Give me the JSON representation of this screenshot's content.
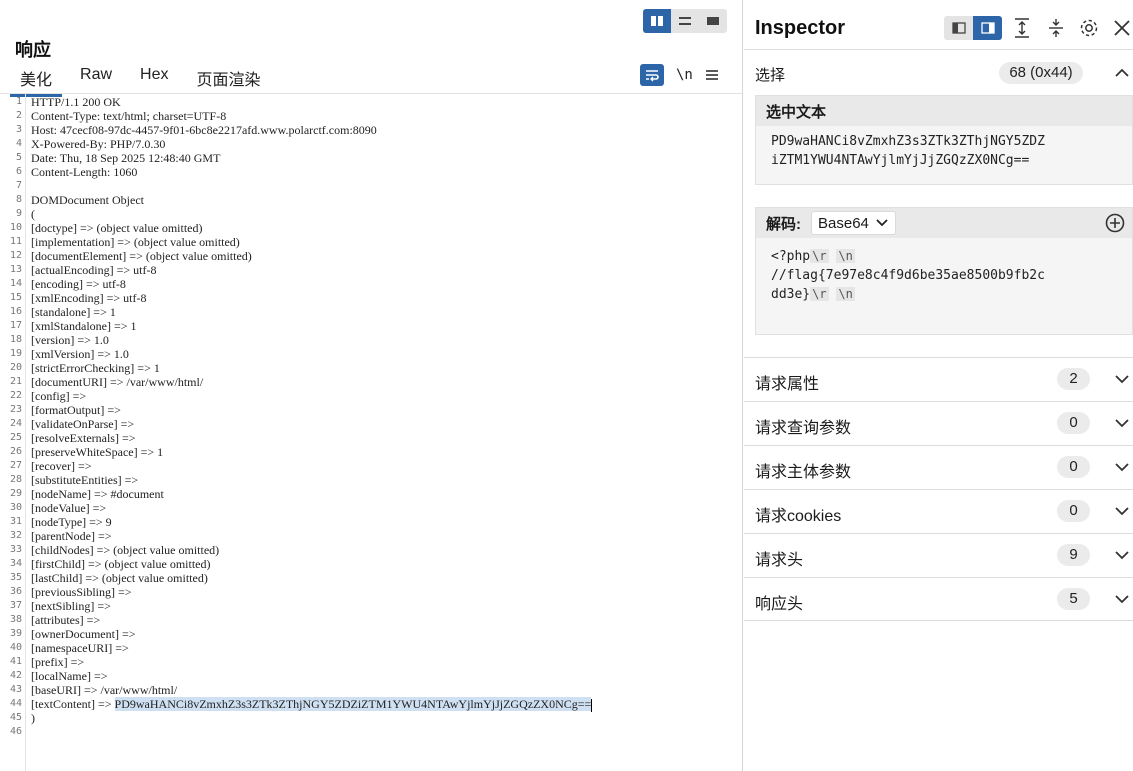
{
  "response": {
    "title": "响应",
    "tabs": [
      {
        "label": "美化",
        "active": true
      },
      {
        "label": "Raw",
        "active": false
      },
      {
        "label": "Hex",
        "active": false
      },
      {
        "label": "页面渲染",
        "active": false
      }
    ],
    "newline_label": "\\n",
    "lines": [
      "HTTP/1.1 200 OK",
      "Content-Type: text/html; charset=UTF-8",
      "Host: 47cecf08-97dc-4457-9f01-6bc8e2217afd.www.polarctf.com:8090",
      "X-Powered-By: PHP/7.0.30",
      "Date: Thu, 18 Sep 2025 12:48:40 GMT",
      "Content-Length: 1060",
      "",
      "DOMDocument Object",
      "(",
      "[doctype] => (object value omitted)",
      "[implementation] => (object value omitted)",
      "[documentElement] => (object value omitted)",
      "[actualEncoding] => utf-8",
      "[encoding] => utf-8",
      "[xmlEncoding] => utf-8",
      "[standalone] => 1",
      "[xmlStandalone] => 1",
      "[version] => 1.0",
      "[xmlVersion] => 1.0",
      "[strictErrorChecking] => 1",
      "[documentURI] => /var/www/html/",
      "[config] =>",
      "[formatOutput] =>",
      "[validateOnParse] =>",
      "[resolveExternals] =>",
      "[preserveWhiteSpace] => 1",
      "[recover] =>",
      "[substituteEntities] =>",
      "[nodeName] => #document",
      "[nodeValue] =>",
      "[nodeType] => 9",
      "[parentNode] =>",
      "[childNodes] => (object value omitted)",
      "[firstChild] => (object value omitted)",
      "[lastChild] => (object value omitted)",
      "[previousSibling] =>",
      "[nextSibling] =>",
      "[attributes] =>",
      "[ownerDocument] =>",
      "[namespaceURI] =>",
      "[prefix] =>",
      "[localName] =>",
      "[baseURI] => /var/www/html/",
      "[textContent] => PD9waHANCi8vZmxhZ3s3ZTk3ZThjNGY5ZDZiZTM1YWU4NTAwYjlmYjJjZGQzZX0NCg==",
      ")",
      ""
    ],
    "highlight": {
      "line_index": 43,
      "prefix": "[textContent] => ",
      "selected": "PD9waHANCi8vZmxhZ3s3ZTk3ZThjNGY5ZDZiZTM1YWU4NTAwYjlmYjJjZGQzZX0NCg=="
    }
  },
  "inspector": {
    "title": "Inspector",
    "selection_label": "选择",
    "selection_badge": "68 (0x44)",
    "selected_text": {
      "header": "选中文本",
      "line1": "PD9waHANCi8vZmxhZ3s3ZTk3ZThjNGY5ZDZ",
      "line2": "iZTM1YWU4NTAwYjlmYjJjZGQzZX0NCg=="
    },
    "decode": {
      "header": "解码:",
      "dropdown": "Base64",
      "line1_text": "<?php",
      "line2_text": "//flag{7e97e8c4f9d6be35ae8500b9fb2c",
      "line3_text": "dd3e}",
      "esc_r": "\\r",
      "esc_n": "\\n"
    },
    "sections": [
      {
        "label": "请求属性",
        "count": "2"
      },
      {
        "label": "请求查询参数",
        "count": "0"
      },
      {
        "label": "请求主体参数",
        "count": "0"
      },
      {
        "label": "请求cookies",
        "count": "0"
      },
      {
        "label": "请求头",
        "count": "9"
      },
      {
        "label": "响应头",
        "count": "5"
      }
    ]
  },
  "colors": {
    "accent": "#2d66a8",
    "selection_highlight": "#cfe0f3"
  }
}
